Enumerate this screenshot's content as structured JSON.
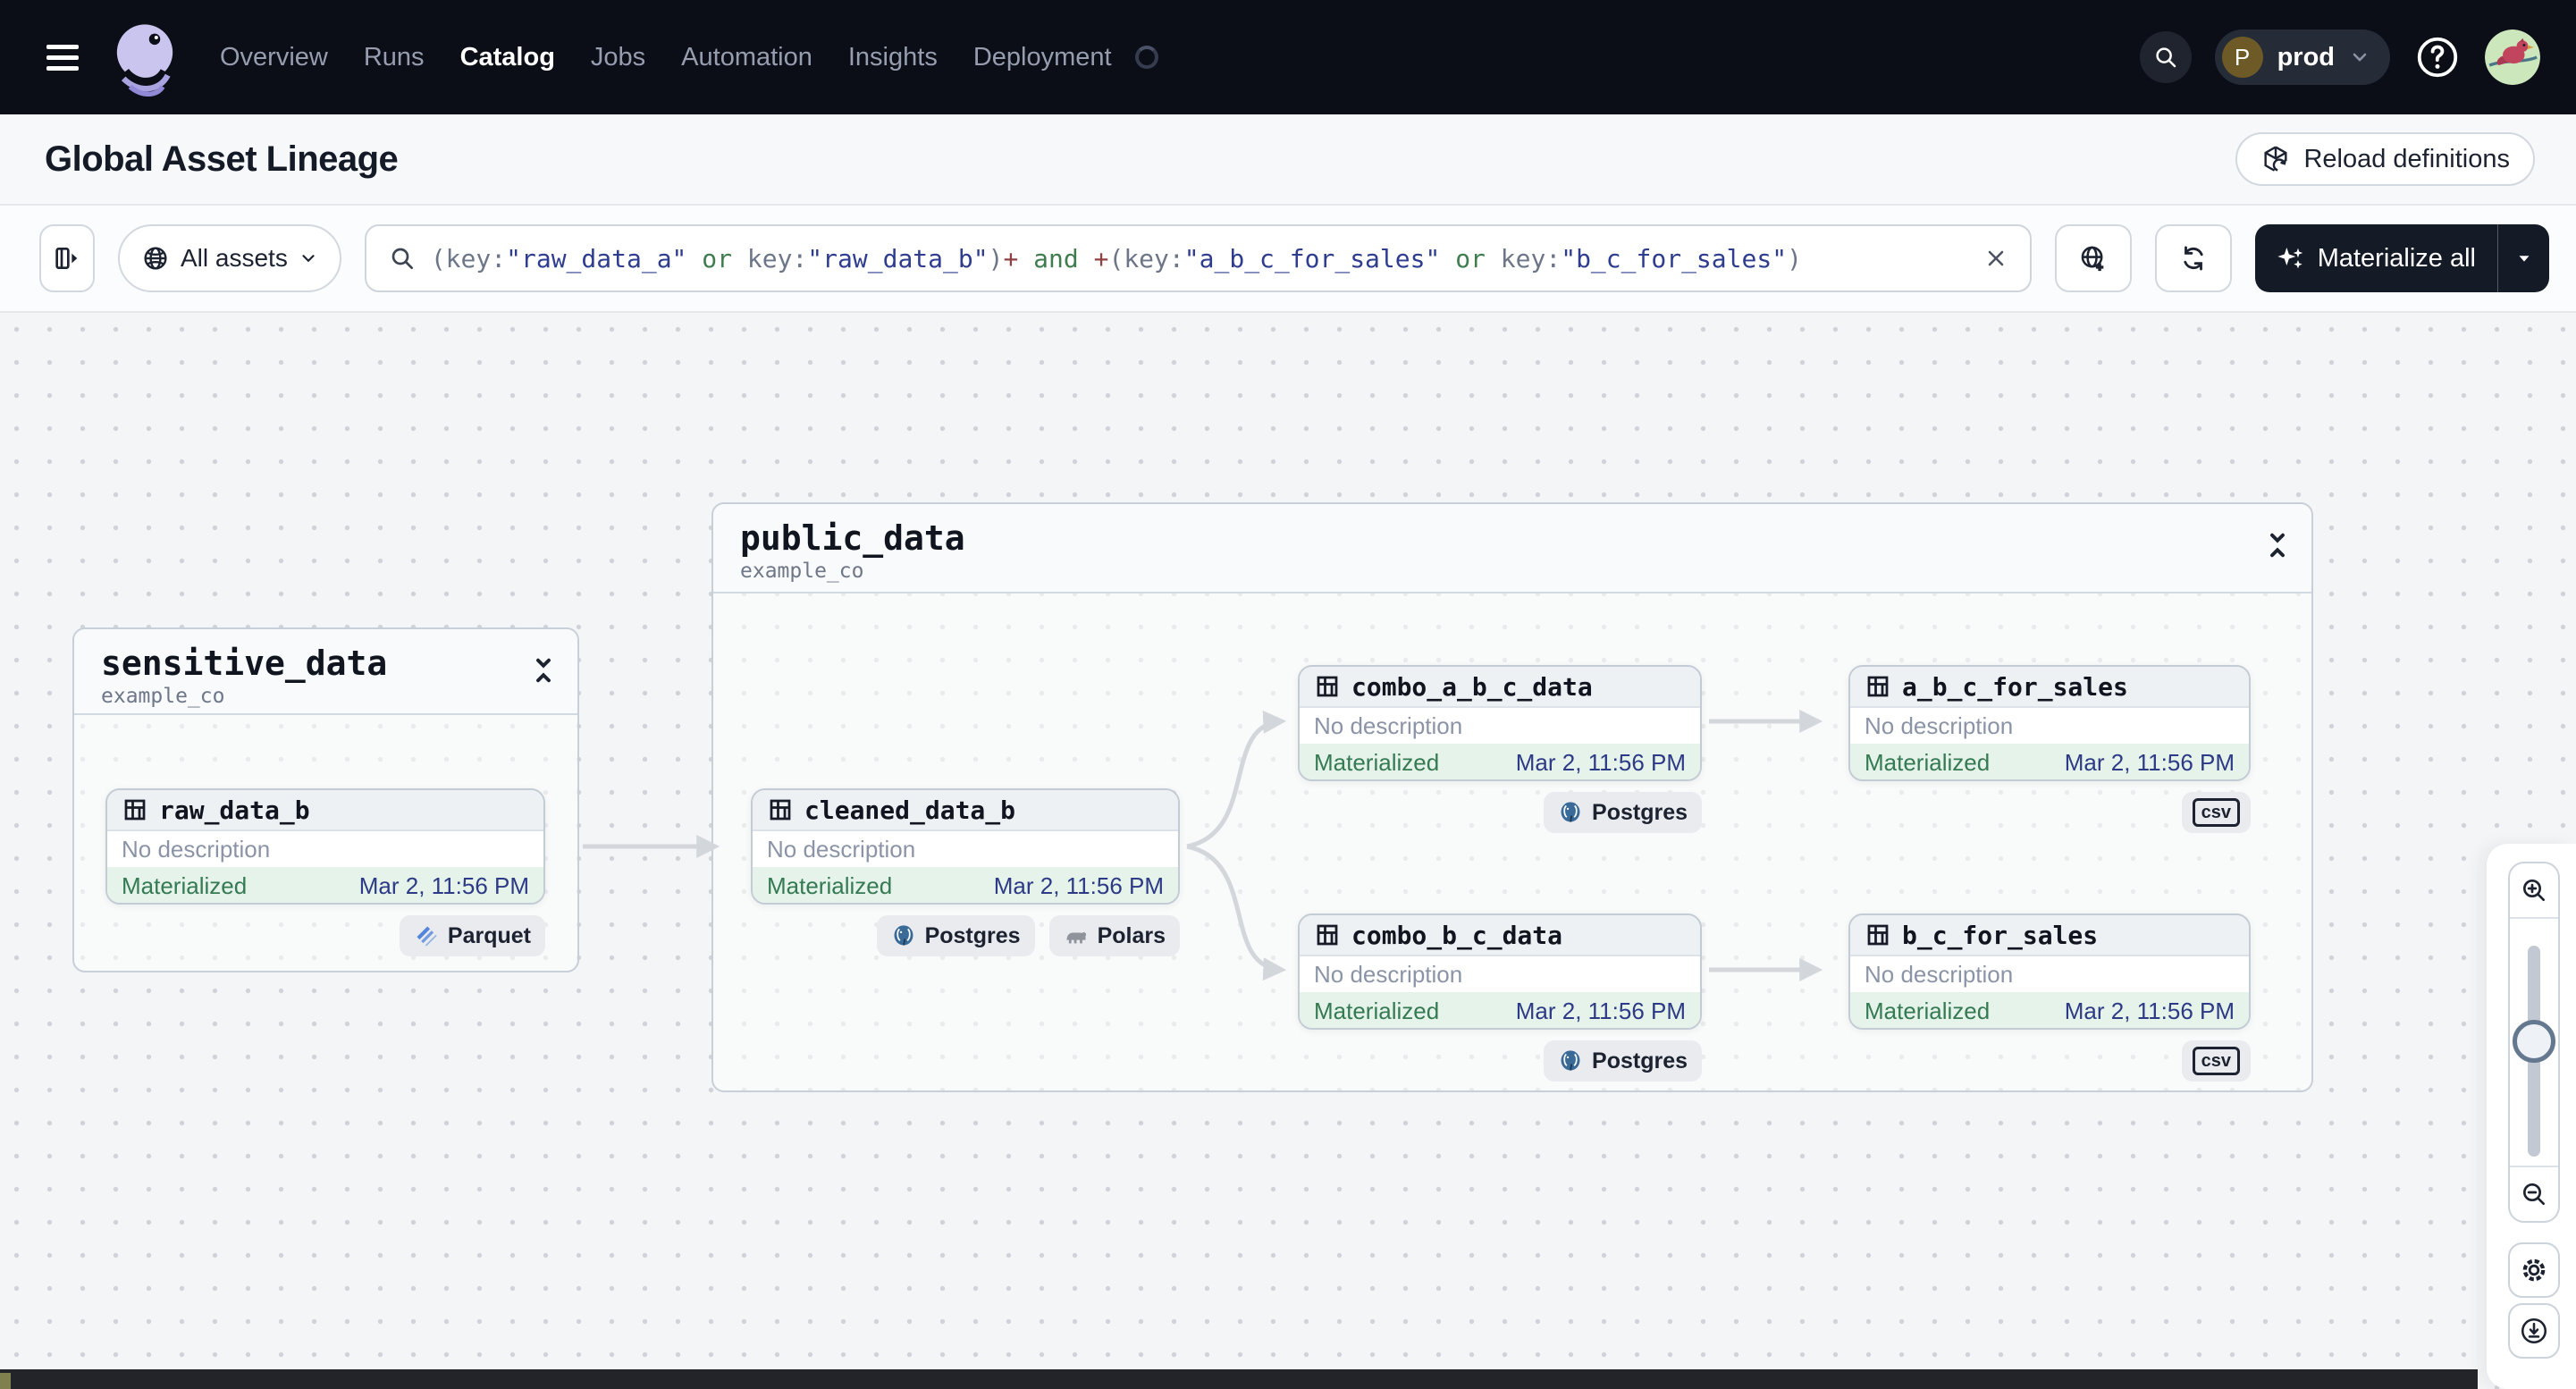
{
  "colors": {
    "nav-bg": "#0c0e17",
    "accent-dark": "#141a26",
    "canvas-bg": "#f4f5f7",
    "status-green-bg": "#e5f3ea",
    "status-green-text": "#357a52",
    "timestamp-navy": "#2d3a85",
    "edge-gray": "#d3d7dc",
    "query-string": "#2f3d8f",
    "query-operator": "#3f7d4f",
    "query-plus": "#8f4040"
  },
  "nav": {
    "items": [
      {
        "label": "Overview"
      },
      {
        "label": "Runs"
      },
      {
        "label": "Catalog"
      },
      {
        "label": "Jobs"
      },
      {
        "label": "Automation"
      },
      {
        "label": "Insights"
      },
      {
        "label": "Deployment"
      }
    ],
    "active_item": "Catalog",
    "deployment": {
      "initial": "P",
      "label": "prod"
    }
  },
  "header": {
    "title": "Global Asset Lineage",
    "reload_button": "Reload definitions"
  },
  "toolbar": {
    "scope_label": "All assets",
    "materialize_label": "Materialize all",
    "query_segments": [
      {
        "t": "(key:"
      },
      {
        "t": "\"raw_data_a\""
      },
      {
        "t": " or "
      },
      {
        "t": "key:"
      },
      {
        "t": "\"raw_data_b\""
      },
      {
        "t": ")"
      },
      {
        "t": "+"
      },
      {
        "t": " and "
      },
      {
        "t": "+"
      },
      {
        "t": "(key:"
      },
      {
        "t": "\"a_b_c_for_sales\""
      },
      {
        "t": " or "
      },
      {
        "t": "key:"
      },
      {
        "t": "\"b_c_for_sales\""
      },
      {
        "t": ")"
      }
    ]
  },
  "graph": {
    "groups": [
      {
        "name": "sensitive_data",
        "repo": "example_co"
      },
      {
        "name": "public_data",
        "repo": "example_co"
      }
    ],
    "nodes": [
      {
        "title": "raw_data_b",
        "description": "No description",
        "status": "Materialized",
        "timestamp": "Mar 2, 11:56 PM",
        "badges": [
          "Parquet"
        ]
      },
      {
        "title": "cleaned_data_b",
        "description": "No description",
        "status": "Materialized",
        "timestamp": "Mar 2, 11:56 PM",
        "badges": [
          "Postgres",
          "Polars"
        ]
      },
      {
        "title": "combo_a_b_c_data",
        "description": "No description",
        "status": "Materialized",
        "timestamp": "Mar 2, 11:56 PM",
        "badges": [
          "Postgres"
        ]
      },
      {
        "title": "a_b_c_for_sales",
        "description": "No description",
        "status": "Materialized",
        "timestamp": "Mar 2, 11:56 PM",
        "badges": [
          "csv"
        ]
      },
      {
        "title": "combo_b_c_data",
        "description": "No description",
        "status": "Materialized",
        "timestamp": "Mar 2, 11:56 PM",
        "badges": [
          "Postgres"
        ]
      },
      {
        "title": "b_c_for_sales",
        "description": "No description",
        "status": "Materialized",
        "timestamp": "Mar 2, 11:56 PM",
        "badges": [
          "csv"
        ]
      }
    ]
  }
}
